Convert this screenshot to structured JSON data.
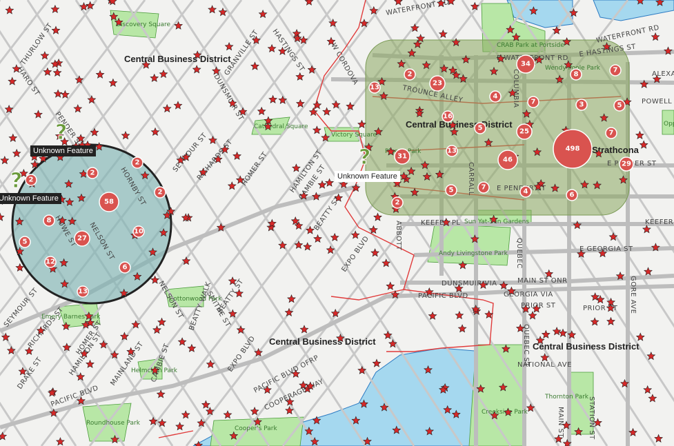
{
  "map": {
    "district_labels": [
      "Central Business District",
      "Central Business District",
      "Central Business District",
      "Central Business District"
    ],
    "neighbourhood_label": "Strathcona",
    "streets": [
      "WATERFRONT RD",
      "W CORDOVA",
      "E WATERFRONT RD",
      "E HASTINGS ST",
      "E PENDER ST",
      "KEEFER PL",
      "KEEFER",
      "E GEORGIA ST",
      "DUNSMUIR VIA",
      "MAIN ST ONR",
      "GEORGIA VIA",
      "PRIOR ST",
      "PACIFIC BLVD",
      "SEYMOUR ST",
      "RICHARDS ST",
      "HOMER ST",
      "HAMILTON ST",
      "CAMBIE ST",
      "BEATTY ST",
      "SMITHE ST",
      "NELSON ST",
      "HORNBY ST",
      "HOWE ST",
      "DUNSMUIR ST",
      "GRANVILLE ST",
      "HASTINGS ST",
      "THURLOW ST",
      "HARO ST",
      "PENDER ST",
      "EXPO BLVD",
      "MAINLAND ST",
      "DRAKE ST",
      "COOPERAGE WAY",
      "PACIFIC BLVD OFRP",
      "NATIONAL AVE",
      "QUEBEC ST",
      "STATION ST",
      "GORE AVE",
      "COLUMBIA",
      "CARRALL",
      "TAYLOR",
      "ABBOTT",
      "BEATTY WALK",
      "POWELL",
      "ALEXA",
      "QUEBEC",
      "MAIN ST",
      "TROUNCE ALLEY"
    ],
    "parks": [
      "Discovery Square",
      "CRAB Park at Portside",
      "Wendy Poole Park",
      "Cathedral Square",
      "Victory Square",
      "Pigeon Park",
      "Sun Yat-Sen Gardens",
      "Andy Livingstone Park",
      "Emery Barnes Park",
      "Roundhouse Park",
      "Helmcken Park",
      "Cooper's Park",
      "Creekside Park",
      "Thornton Park",
      "Cottonwood Park",
      "Oppenheimer"
    ],
    "tooltips": [
      "Unknown Feature",
      "Unknown Feature",
      "Unknown Feature"
    ],
    "left_clusters": [
      "2",
      "2",
      "58",
      "2",
      "8",
      "10",
      "5",
      "27",
      "12",
      "6",
      "13",
      "2"
    ],
    "right_clusters": [
      "2",
      "34",
      "8",
      "7",
      "13",
      "23",
      "4",
      "7",
      "3",
      "5",
      "16",
      "5",
      "25",
      "7",
      "498",
      "13",
      "31",
      "46",
      "29",
      "5",
      "7",
      "4",
      "6",
      "2"
    ]
  },
  "colors": {
    "water": "#a5d8ef",
    "park": "#b8e7a6",
    "road": "#c8c8c8",
    "marker": "#d62828",
    "cluster": "#d9534f",
    "circle_fill": "#7fb3b3",
    "region_fill": "#8aa860",
    "boundary": "#e03a3a"
  },
  "icons": [
    "star-marker-icon",
    "unknown-feature-icon",
    "cluster-icon"
  ]
}
